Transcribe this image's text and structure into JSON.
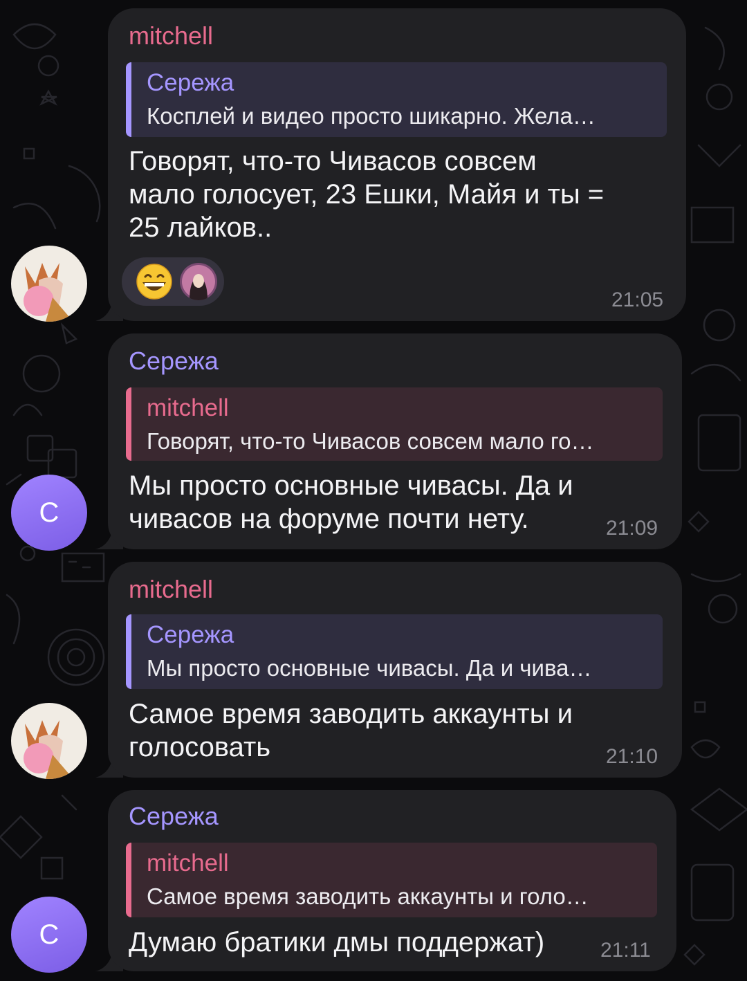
{
  "colors": {
    "background": "#0b0b0d",
    "bubble": "#212124",
    "name_mitchell": "#e86b8e",
    "name_serezha": "#a596ff",
    "reply_bg_serezha": "#2f2d3f",
    "reply_bg_mitchell": "#3a2830",
    "time": "#8c8c93"
  },
  "messages": [
    {
      "sender": "mitchell",
      "reply": {
        "name": "Сережа",
        "text": "Косплей и видео просто шикарно.  Жела…"
      },
      "text_lines": [
        "Говорят, что-то Чивасов совсем",
        "мало голосует, 23 Ешки, Майя и ты =",
        "25 лайков.."
      ],
      "time": "21:05",
      "reactions": [
        {
          "type": "emoji",
          "value": "😁",
          "icon": "grinning-face-icon"
        },
        {
          "type": "avatar",
          "icon": "reactor-avatar"
        }
      ],
      "avatar": {
        "type": "image",
        "icon": "mitchell-avatar"
      }
    },
    {
      "sender": "Сережа",
      "reply": {
        "name": "mitchell",
        "text": "Говорят, что-то Чивасов совсем мало го…"
      },
      "text_lines": [
        "Мы просто основные чивасы. Да и",
        "чивасов на форуме почти нету."
      ],
      "time": "21:09",
      "avatar": {
        "type": "letter",
        "letter": "С"
      }
    },
    {
      "sender": "mitchell",
      "reply": {
        "name": "Сережа",
        "text": "Мы просто основные чивасы. Да и чива…"
      },
      "text_lines": [
        "Самое время заводить аккаунты и",
        "голосовать"
      ],
      "time": "21:10",
      "avatar": {
        "type": "image",
        "icon": "mitchell-avatar"
      }
    },
    {
      "sender": "Сережа",
      "reply": {
        "name": "mitchell",
        "text": "Самое время заводить аккаунты и голо…"
      },
      "text_lines": [
        "Думаю братики дмы поддержат)"
      ],
      "time": "21:11",
      "avatar": {
        "type": "letter",
        "letter": "С"
      }
    }
  ]
}
